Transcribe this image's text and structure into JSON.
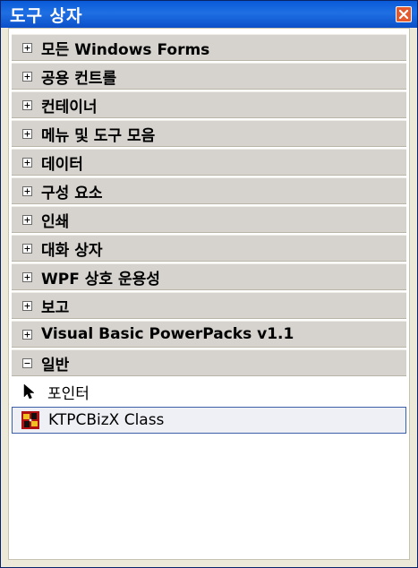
{
  "window": {
    "title": "도구 상자"
  },
  "groups": [
    {
      "label": "모든 Windows Forms",
      "state": "collapsed"
    },
    {
      "label": "공용 컨트롤",
      "state": "collapsed"
    },
    {
      "label": "컨테이너",
      "state": "collapsed"
    },
    {
      "label": "메뉴 및 도구 모음",
      "state": "collapsed"
    },
    {
      "label": "데이터",
      "state": "collapsed"
    },
    {
      "label": "구성 요소",
      "state": "collapsed"
    },
    {
      "label": "인쇄",
      "state": "collapsed"
    },
    {
      "label": "대화 상자",
      "state": "collapsed"
    },
    {
      "label": "WPF 상호 운용성",
      "state": "collapsed"
    },
    {
      "label": "보고",
      "state": "collapsed"
    },
    {
      "label": "Visual Basic PowerPacks v1.1",
      "state": "collapsed"
    },
    {
      "label": "일반",
      "state": "expanded"
    }
  ],
  "items": [
    {
      "label": "포인터",
      "icon": "pointer-icon",
      "selected": false
    },
    {
      "label": "KTPCBizX Class",
      "icon": "ktpcbizx-component-icon",
      "selected": true
    }
  ],
  "colors": {
    "titlebar": "#0a5ad8",
    "close_button": "#e35a2e",
    "group_header": "#d6d3ce",
    "selection_border": "#3b5fa8"
  }
}
